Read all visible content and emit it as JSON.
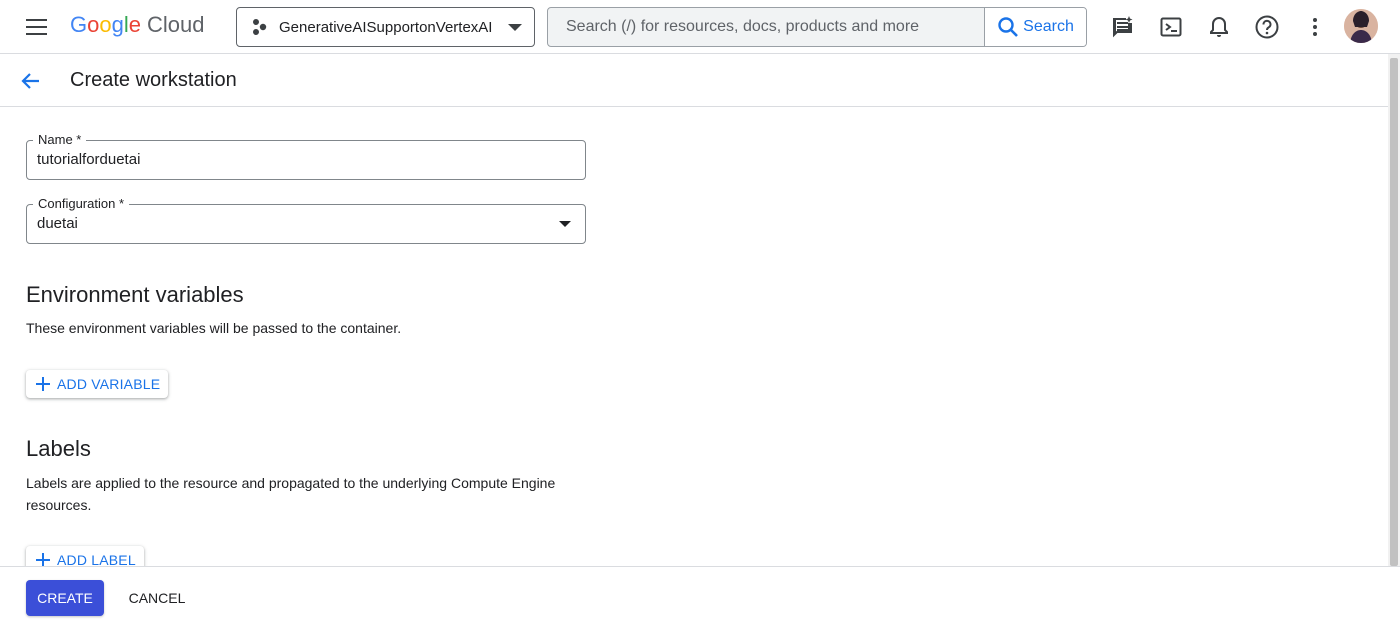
{
  "topbar": {
    "logo_google": "Google",
    "logo_cloud": "Cloud",
    "project_name": "GenerativeAISupportonVertexAI",
    "search_placeholder": "Search (/) for resources, docs, products and more",
    "search_button": "Search",
    "icons": [
      "menu-icon",
      "project-icon",
      "search-icon",
      "feedback-icon",
      "cloud-shell-icon",
      "notifications-icon",
      "help-icon",
      "more-vert-icon",
      "avatar"
    ]
  },
  "header": {
    "title": "Create workstation"
  },
  "form": {
    "name_label": "Name *",
    "name_value": "tutorialforduetai",
    "config_label": "Configuration *",
    "config_value": "duetai"
  },
  "env": {
    "title": "Environment variables",
    "description": "These environment variables will be passed to the container.",
    "add_button": "ADD VARIABLE"
  },
  "labels": {
    "title": "Labels",
    "description": "Labels are applied to the resource and propagated to the underlying Compute Engine resources.",
    "add_button": "ADD LABEL"
  },
  "footer": {
    "create": "CREATE",
    "cancel": "CANCEL"
  },
  "colors": {
    "accent": "#1a73e8",
    "primary_button": "#3b4fd8",
    "border": "#dadce0"
  }
}
